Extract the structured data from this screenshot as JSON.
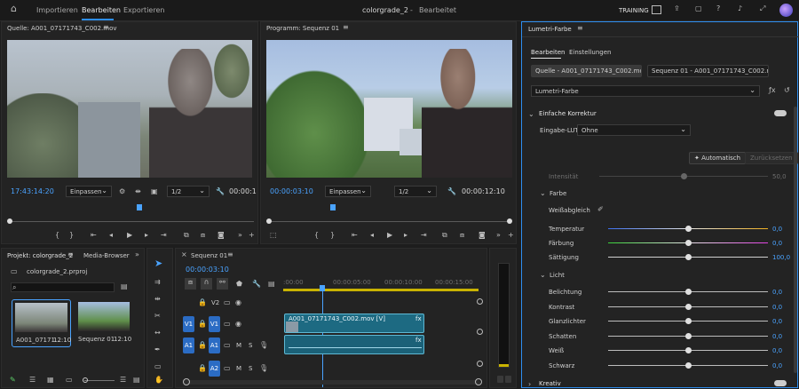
{
  "header": {
    "home_icon": "home-icon",
    "tabs": [
      {
        "label": "Importieren"
      },
      {
        "label": "Bearbeiten"
      },
      {
        "label": "Exportieren"
      }
    ],
    "project_title": "colorgrade_2",
    "separator": "-",
    "status": "Bearbeitet",
    "workspace_label": "TRAINING"
  },
  "source_monitor": {
    "title": "Quelle: A001_07171743_C002.mov",
    "timecode": "17:43:14:20",
    "fit": "Einpassen",
    "resolution": "1/2",
    "duration": "00:00:1"
  },
  "program_monitor": {
    "title": "Programm: Sequenz 01",
    "timecode": "00:00:03:10",
    "fit": "Einpassen",
    "resolution": "1/2",
    "duration": "00:00:12:10"
  },
  "project_panel": {
    "tabs": [
      {
        "label": "Projekt: colorgrade_2"
      },
      {
        "label": "Media-Browser"
      }
    ],
    "file": "colorgrade_2.prproj",
    "items": [
      {
        "name": "A001_07171...",
        "duration": "12:10"
      },
      {
        "name": "Sequenz 01",
        "duration": "12:10"
      }
    ]
  },
  "timeline": {
    "title": "Sequenz 01",
    "timecode": "00:00:03:10",
    "ruler": [
      ":00:00",
      "00:00:05:00",
      "00:00:10:00",
      "00:00:15:00"
    ],
    "video_tracks": [
      {
        "src": "V2",
        "label": "V2"
      },
      {
        "src": "V1",
        "label": "V1"
      }
    ],
    "audio_tracks": [
      {
        "src": "A1",
        "label": "A1",
        "m": "M",
        "s": "S"
      },
      {
        "src": "A2",
        "label": "A2",
        "m": "M",
        "s": "S"
      }
    ],
    "video_clip": "A001_07171743_C002.mov [V]",
    "fx": "fx"
  },
  "lumetri": {
    "panel_title": "Lumetri-Farbe",
    "tabs": [
      {
        "label": "Bearbeiten"
      },
      {
        "label": "Einstellungen"
      }
    ],
    "source_chip": "Quelle - A001_07171743_C002.mov",
    "sequence_chip": "Sequenz 01 - A001_07171743_C002.mov",
    "effect_select": "Lumetri-Farbe",
    "section_basic": "Einfache Korrektur",
    "input_lut_label": "Eingabe-LUT",
    "input_lut_value": "Ohne",
    "auto_button": "Automatisch",
    "reset_button": "Zurücksetzen",
    "intensity_label": "Intensität",
    "intensity_value": "50,0",
    "color_group": "Farbe",
    "white_balance_label": "Weißabgleich",
    "sliders_color": [
      {
        "label": "Temperatur",
        "value": "0,0",
        "level": 0.5
      },
      {
        "label": "Färbung",
        "value": "0,0",
        "level": 0.5
      },
      {
        "label": "Sättigung",
        "value": "100,0",
        "level": 0.5
      }
    ],
    "light_group": "Licht",
    "sliders_light": [
      {
        "label": "Belichtung",
        "value": "0,0",
        "level": 0.5
      },
      {
        "label": "Kontrast",
        "value": "0,0",
        "level": 0.5
      },
      {
        "label": "Glanzlichter",
        "value": "0,0",
        "level": 0.5
      },
      {
        "label": "Schatten",
        "value": "0,0",
        "level": 0.5
      },
      {
        "label": "Weiß",
        "value": "0,0",
        "level": 0.5
      },
      {
        "label": "Schwarz",
        "value": "0,0",
        "level": 0.5
      }
    ],
    "section_creative": "Kreativ"
  },
  "colors": {
    "accent": "#2e8ef0",
    "timecode": "#4aa3ff",
    "clip": "#1d6a82"
  }
}
